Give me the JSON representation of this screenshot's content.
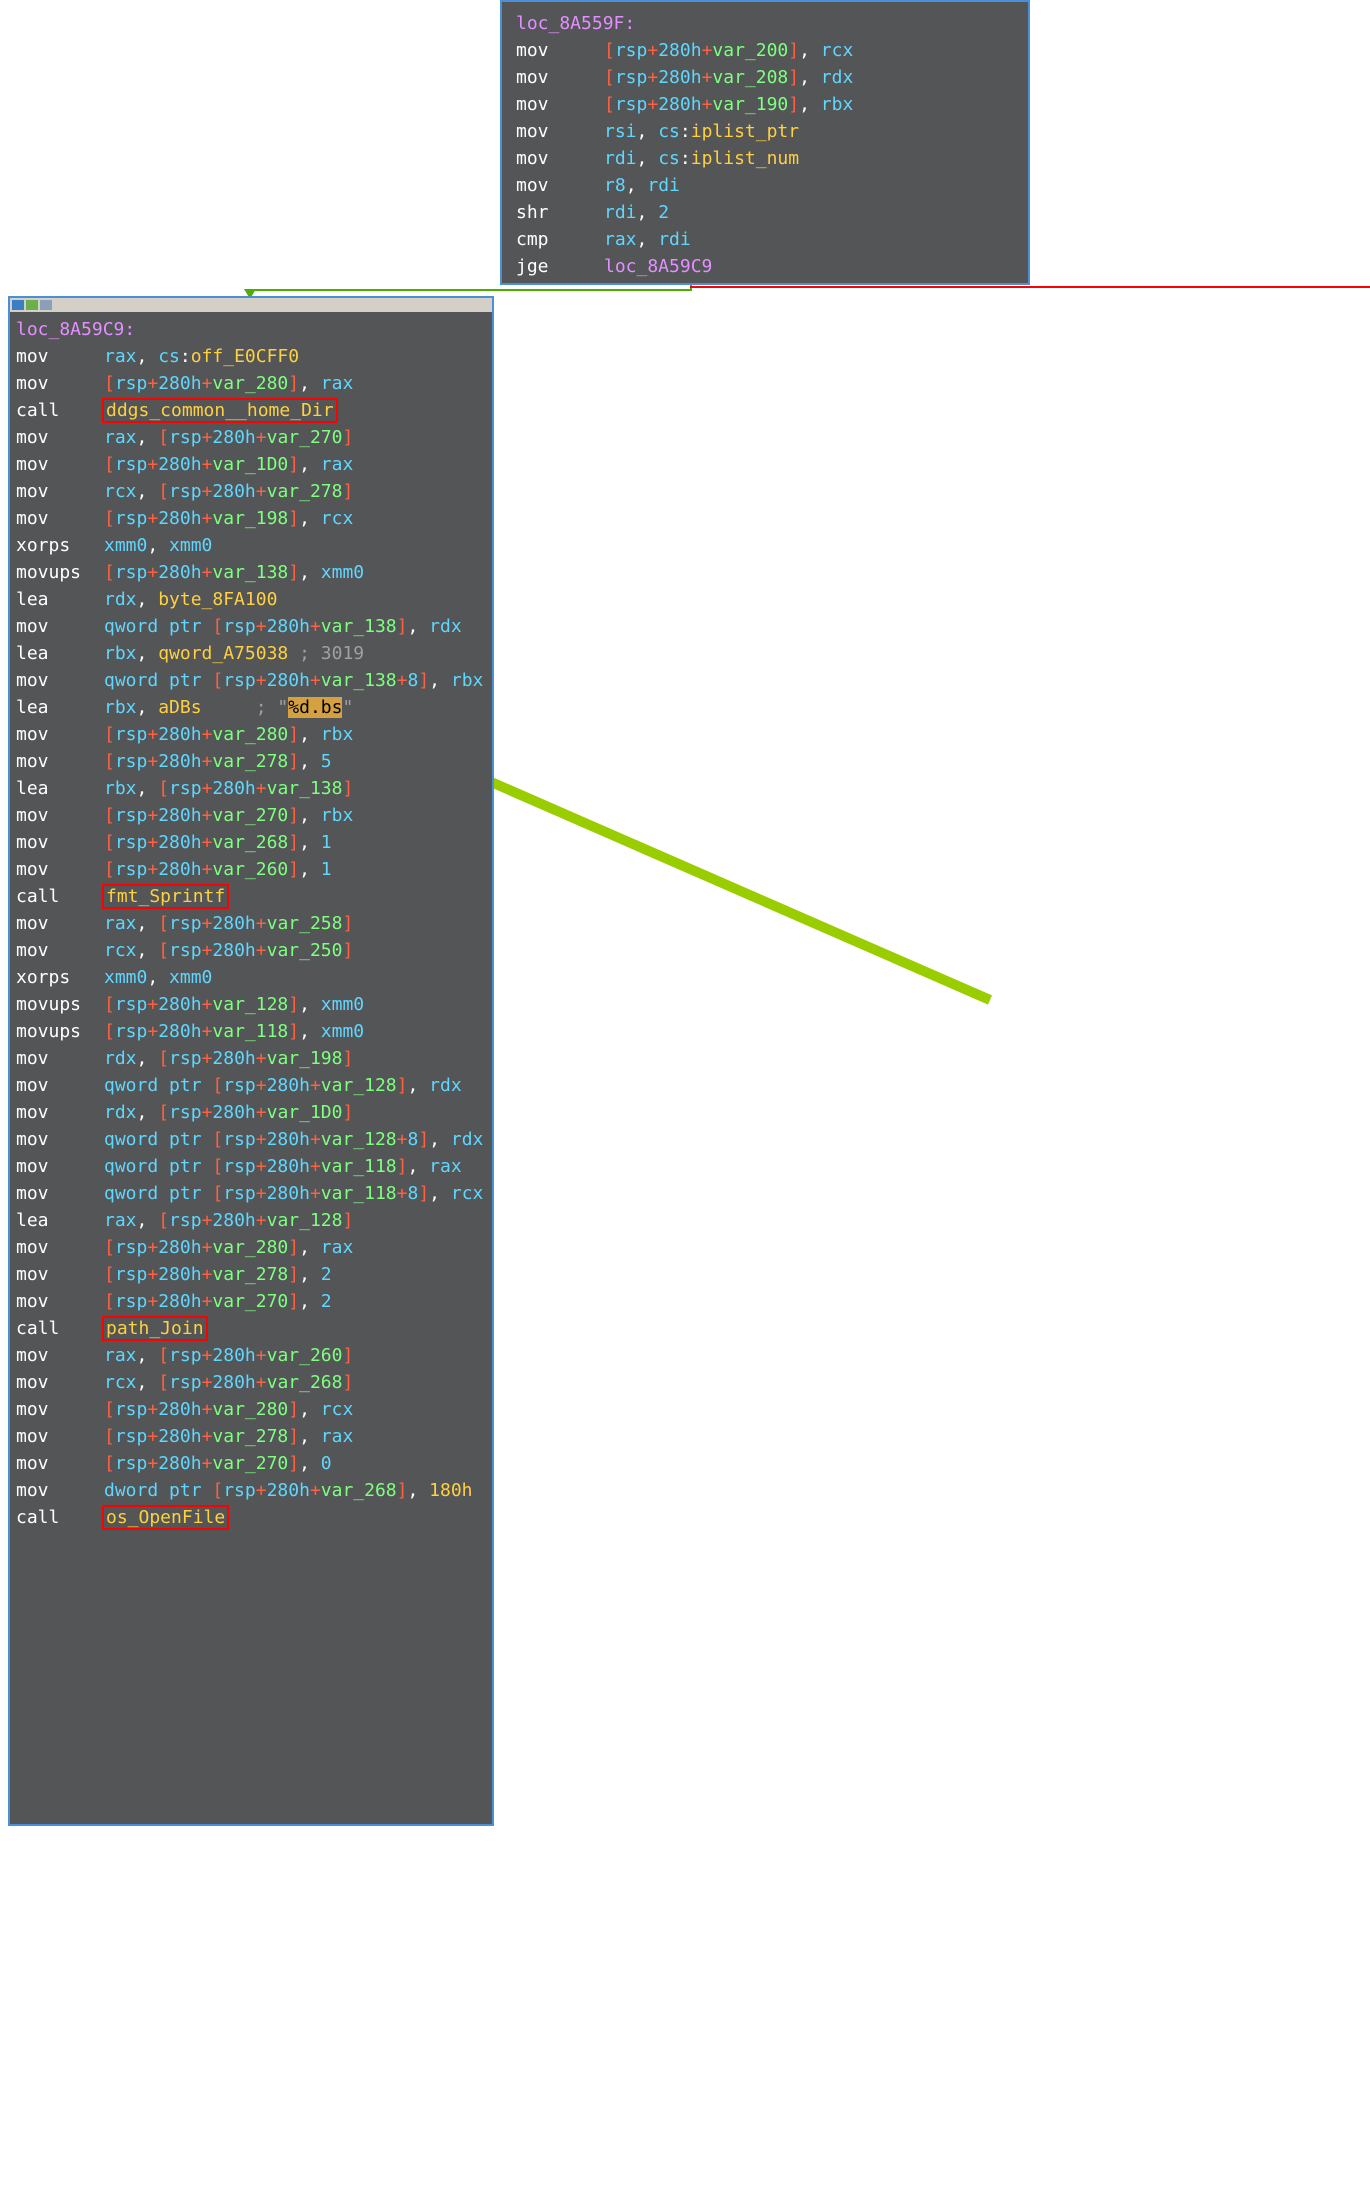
{
  "top_block": {
    "label": "loc_8A559F:",
    "lines": [
      {
        "m": "mov",
        "o": [
          {
            "t": "mem",
            "txt": "[rsp+280h+var_200]"
          },
          {
            "t": "reg",
            "txt": "rcx"
          }
        ]
      },
      {
        "m": "mov",
        "o": [
          {
            "t": "mem",
            "txt": "[rsp+280h+var_208]"
          },
          {
            "t": "reg",
            "txt": "rdx"
          }
        ]
      },
      {
        "m": "mov",
        "o": [
          {
            "t": "mem",
            "txt": "[rsp+280h+var_190]"
          },
          {
            "t": "reg",
            "txt": "rbx"
          }
        ]
      },
      {
        "m": "mov",
        "o": [
          {
            "t": "reg",
            "txt": "rsi"
          },
          {
            "t": "cs",
            "txt": "cs:iplist_ptr"
          }
        ]
      },
      {
        "m": "mov",
        "o": [
          {
            "t": "reg",
            "txt": "rdi"
          },
          {
            "t": "cs",
            "txt": "cs:iplist_num"
          }
        ]
      },
      {
        "m": "mov",
        "o": [
          {
            "t": "reg",
            "txt": "r8"
          },
          {
            "t": "reg",
            "txt": "rdi"
          }
        ]
      },
      {
        "m": "shr",
        "o": [
          {
            "t": "reg",
            "txt": "rdi"
          },
          {
            "t": "num",
            "txt": "2"
          }
        ]
      },
      {
        "m": "cmp",
        "o": [
          {
            "t": "reg",
            "txt": "rax"
          },
          {
            "t": "reg",
            "txt": "rdi"
          }
        ]
      },
      {
        "m": "jge",
        "o": [
          {
            "t": "label",
            "txt": "loc_8A59C9"
          }
        ]
      }
    ]
  },
  "main_block": {
    "label": "loc_8A59C9:",
    "lines": [
      {
        "m": "mov",
        "o": [
          {
            "t": "reg",
            "txt": "rax"
          },
          {
            "t": "cs",
            "txt": "cs:off_E0CFF0"
          }
        ]
      },
      {
        "m": "mov",
        "o": [
          {
            "t": "mem",
            "txt": "[rsp+280h+var_280]"
          },
          {
            "t": "reg",
            "txt": "rax"
          }
        ]
      },
      {
        "m": "call",
        "o": [
          {
            "t": "call",
            "txt": "ddgs_common__home_Dir",
            "boxed": true
          }
        ]
      },
      {
        "m": "mov",
        "o": [
          {
            "t": "reg",
            "txt": "rax"
          },
          {
            "t": "mem",
            "txt": "[rsp+280h+var_270]"
          }
        ]
      },
      {
        "m": "mov",
        "o": [
          {
            "t": "mem",
            "txt": "[rsp+280h+var_1D0]"
          },
          {
            "t": "reg",
            "txt": "rax"
          }
        ]
      },
      {
        "m": "mov",
        "o": [
          {
            "t": "reg",
            "txt": "rcx"
          },
          {
            "t": "mem",
            "txt": "[rsp+280h+var_278]"
          }
        ]
      },
      {
        "m": "mov",
        "o": [
          {
            "t": "mem",
            "txt": "[rsp+280h+var_198]"
          },
          {
            "t": "reg",
            "txt": "rcx"
          }
        ]
      },
      {
        "m": "xorps",
        "o": [
          {
            "t": "reg",
            "txt": "xmm0"
          },
          {
            "t": "reg",
            "txt": "xmm0"
          }
        ]
      },
      {
        "m": "movups",
        "o": [
          {
            "t": "mem",
            "txt": "[rsp+280h+var_138]"
          },
          {
            "t": "reg",
            "txt": "xmm0"
          }
        ]
      },
      {
        "m": "lea",
        "o": [
          {
            "t": "reg",
            "txt": "rdx"
          },
          {
            "t": "sym",
            "txt": "byte_8FA100"
          }
        ]
      },
      {
        "m": "mov",
        "o": [
          {
            "t": "qmem",
            "txt": "qword ptr [rsp+280h+var_138]"
          },
          {
            "t": "reg",
            "txt": "rdx"
          }
        ]
      },
      {
        "m": "lea",
        "o": [
          {
            "t": "reg",
            "txt": "rbx"
          },
          {
            "t": "sym",
            "txt": "qword_A75038"
          }
        ],
        "comment": "; 3019"
      },
      {
        "m": "mov",
        "o": [
          {
            "t": "qmem8",
            "txt": "qword ptr [rsp+280h+var_138+8]"
          },
          {
            "t": "reg",
            "txt": "rbx"
          }
        ]
      },
      {
        "m": "lea",
        "o": [
          {
            "t": "reg",
            "txt": "rbx"
          },
          {
            "t": "sym",
            "txt": "aDBs"
          }
        ],
        "strcomment": {
          "pre": "; \"",
          "body": "%d.bs",
          "post": "\""
        }
      },
      {
        "m": "mov",
        "o": [
          {
            "t": "mem",
            "txt": "[rsp+280h+var_280]"
          },
          {
            "t": "reg",
            "txt": "rbx"
          }
        ]
      },
      {
        "m": "mov",
        "o": [
          {
            "t": "mem",
            "txt": "[rsp+280h+var_278]"
          },
          {
            "t": "num",
            "txt": "5"
          }
        ]
      },
      {
        "m": "lea",
        "o": [
          {
            "t": "reg",
            "txt": "rbx"
          },
          {
            "t": "mem",
            "txt": "[rsp+280h+var_138]"
          }
        ]
      },
      {
        "m": "mov",
        "o": [
          {
            "t": "mem",
            "txt": "[rsp+280h+var_270]"
          },
          {
            "t": "reg",
            "txt": "rbx"
          }
        ]
      },
      {
        "m": "mov",
        "o": [
          {
            "t": "mem",
            "txt": "[rsp+280h+var_268]"
          },
          {
            "t": "num",
            "txt": "1"
          }
        ]
      },
      {
        "m": "mov",
        "o": [
          {
            "t": "mem",
            "txt": "[rsp+280h+var_260]"
          },
          {
            "t": "num",
            "txt": "1"
          }
        ]
      },
      {
        "m": "call",
        "o": [
          {
            "t": "call",
            "txt": "fmt_Sprintf",
            "boxed": true
          }
        ]
      },
      {
        "m": "mov",
        "o": [
          {
            "t": "reg",
            "txt": "rax"
          },
          {
            "t": "mem",
            "txt": "[rsp+280h+var_258]"
          }
        ]
      },
      {
        "m": "mov",
        "o": [
          {
            "t": "reg",
            "txt": "rcx"
          },
          {
            "t": "mem",
            "txt": "[rsp+280h+var_250]"
          }
        ]
      },
      {
        "m": "xorps",
        "o": [
          {
            "t": "reg",
            "txt": "xmm0"
          },
          {
            "t": "reg",
            "txt": "xmm0"
          }
        ]
      },
      {
        "m": "movups",
        "o": [
          {
            "t": "mem",
            "txt": "[rsp+280h+var_128]"
          },
          {
            "t": "reg",
            "txt": "xmm0"
          }
        ]
      },
      {
        "m": "movups",
        "o": [
          {
            "t": "mem",
            "txt": "[rsp+280h+var_118]"
          },
          {
            "t": "reg",
            "txt": "xmm0"
          }
        ]
      },
      {
        "m": "mov",
        "o": [
          {
            "t": "reg",
            "txt": "rdx"
          },
          {
            "t": "mem",
            "txt": "[rsp+280h+var_198]"
          }
        ]
      },
      {
        "m": "mov",
        "o": [
          {
            "t": "qmem",
            "txt": "qword ptr [rsp+280h+var_128]"
          },
          {
            "t": "reg",
            "txt": "rdx"
          }
        ]
      },
      {
        "m": "mov",
        "o": [
          {
            "t": "reg",
            "txt": "rdx"
          },
          {
            "t": "mem",
            "txt": "[rsp+280h+var_1D0]"
          }
        ]
      },
      {
        "m": "mov",
        "o": [
          {
            "t": "qmem8",
            "txt": "qword ptr [rsp+280h+var_128+8]"
          },
          {
            "t": "reg",
            "txt": "rdx"
          }
        ]
      },
      {
        "m": "mov",
        "o": [
          {
            "t": "qmem",
            "txt": "qword ptr [rsp+280h+var_118]"
          },
          {
            "t": "reg",
            "txt": "rax"
          }
        ]
      },
      {
        "m": "mov",
        "o": [
          {
            "t": "qmem8",
            "txt": "qword ptr [rsp+280h+var_118+8]"
          },
          {
            "t": "reg",
            "txt": "rcx"
          }
        ]
      },
      {
        "m": "lea",
        "o": [
          {
            "t": "reg",
            "txt": "rax"
          },
          {
            "t": "mem",
            "txt": "[rsp+280h+var_128]"
          }
        ]
      },
      {
        "m": "mov",
        "o": [
          {
            "t": "mem",
            "txt": "[rsp+280h+var_280]"
          },
          {
            "t": "reg",
            "txt": "rax"
          }
        ]
      },
      {
        "m": "mov",
        "o": [
          {
            "t": "mem",
            "txt": "[rsp+280h+var_278]"
          },
          {
            "t": "num",
            "txt": "2"
          }
        ]
      },
      {
        "m": "mov",
        "o": [
          {
            "t": "mem",
            "txt": "[rsp+280h+var_270]"
          },
          {
            "t": "num",
            "txt": "2"
          }
        ]
      },
      {
        "m": "call",
        "o": [
          {
            "t": "call",
            "txt": "path_Join",
            "boxed": true
          }
        ]
      },
      {
        "m": "mov",
        "o": [
          {
            "t": "reg",
            "txt": "rax"
          },
          {
            "t": "mem",
            "txt": "[rsp+280h+var_260]"
          }
        ]
      },
      {
        "m": "mov",
        "o": [
          {
            "t": "reg",
            "txt": "rcx"
          },
          {
            "t": "mem",
            "txt": "[rsp+280h+var_268]"
          }
        ]
      },
      {
        "m": "mov",
        "o": [
          {
            "t": "mem",
            "txt": "[rsp+280h+var_280]"
          },
          {
            "t": "reg",
            "txt": "rcx"
          }
        ]
      },
      {
        "m": "mov",
        "o": [
          {
            "t": "mem",
            "txt": "[rsp+280h+var_278]"
          },
          {
            "t": "reg",
            "txt": "rax"
          }
        ]
      },
      {
        "m": "mov",
        "o": [
          {
            "t": "mem",
            "txt": "[rsp+280h+var_270]"
          },
          {
            "t": "num",
            "txt": "0"
          }
        ]
      },
      {
        "m": "mov",
        "o": [
          {
            "t": "dmem",
            "txt": "dword ptr [rsp+280h+var_268]"
          },
          {
            "t": "hexnum",
            "txt": "180h"
          }
        ]
      },
      {
        "m": "call",
        "o": [
          {
            "t": "call",
            "txt": "os_OpenFile",
            "boxed": true
          }
        ]
      }
    ]
  }
}
